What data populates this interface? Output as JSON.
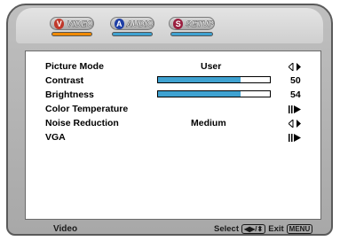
{
  "tabs": [
    {
      "label": "VIDEO",
      "badge": "V",
      "badge_color": "#c0392b",
      "underline_color": "#f08a00"
    },
    {
      "label": "AUDIO",
      "badge": "A",
      "badge_color": "#1f3fa6",
      "underline_color": "#3fa2d1"
    },
    {
      "label": "SETUP",
      "badge": "S",
      "badge_color": "#9a1f3f",
      "underline_color": "#3fa2d1"
    }
  ],
  "menu": {
    "picture_mode": {
      "label": "Picture Mode",
      "value": "User",
      "icon": "left-right-arrows-icon"
    },
    "contrast": {
      "label": "Contrast",
      "value": "50",
      "level_percent": 74
    },
    "brightness": {
      "label": "Brightness",
      "value": "54",
      "level_percent": 74
    },
    "color_temperature": {
      "label": "Color Temperature",
      "icon": "enter-submenu-icon"
    },
    "noise_reduction": {
      "label": "Noise Reduction",
      "value": "Medium",
      "icon": "left-right-arrows-icon"
    },
    "vga": {
      "label": "VGA",
      "icon": "enter-submenu-icon"
    }
  },
  "footer": {
    "title": "Video",
    "select_label": "Select",
    "select_keys": "◀▶/⬍",
    "exit_label": "Exit",
    "exit_key": "MENU"
  },
  "colors": {
    "slider_fill": "#3fa2d1",
    "frame": "#b4b4b4"
  }
}
